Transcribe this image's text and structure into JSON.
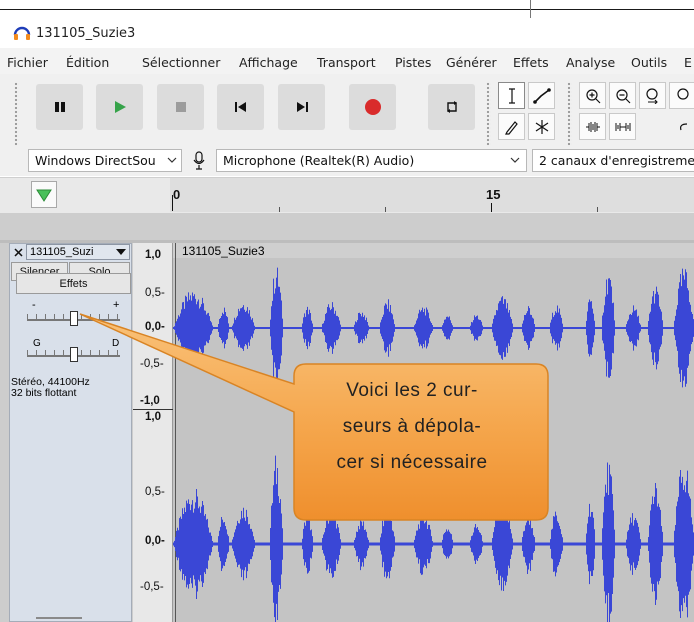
{
  "window": {
    "title": "131105_Suzie3"
  },
  "menu": [
    "Fichier",
    "Édition",
    "Sélectionner",
    "Affichage",
    "Transport",
    "Pistes",
    "Générer",
    "Effets",
    "Analyse",
    "Outils",
    "E"
  ],
  "transport": {
    "pause": "pause-icon",
    "play": "play-icon",
    "stop": "stop-icon",
    "skip_start": "skip-to-start-icon",
    "skip_end": "skip-to-end-icon",
    "record": "record-icon",
    "loop": "loop-icon"
  },
  "colors": {
    "play": "#36a34a",
    "record": "#d92b2b",
    "waveform": "#3a47d6",
    "callout": "#f5a64c"
  },
  "devices": {
    "host": "Windows DirectSou",
    "recording_device": "Microphone (Realtek(R) Audio)",
    "channels": "2 canaux d'enregistreme"
  },
  "timeline": {
    "labels": [
      "0",
      "15"
    ]
  },
  "track": {
    "name": "131105_Suzi",
    "clip_name": "131105_Suzie3",
    "mute": "Silencer",
    "solo": "Solo",
    "effects": "Effets",
    "gain_minus": "-",
    "gain_plus": "+",
    "pan_left": "G",
    "pan_right": "D",
    "format_line1": "Stéréo, 44100Hz",
    "format_line2": "32 bits flottant",
    "gain_level": 0.5,
    "pan_level": 0.5
  },
  "vruler": {
    "top": [
      "1,0",
      "0,5-",
      "0,0-",
      "-0,5-",
      "-1,0"
    ],
    "bottom": [
      "1,0",
      "0,5-",
      "0,0-",
      "-0,5-"
    ]
  },
  "callout": {
    "lines": [
      "Voici les 2 cur-",
      "seurs à dépola-",
      "cer si nécessaire"
    ]
  }
}
